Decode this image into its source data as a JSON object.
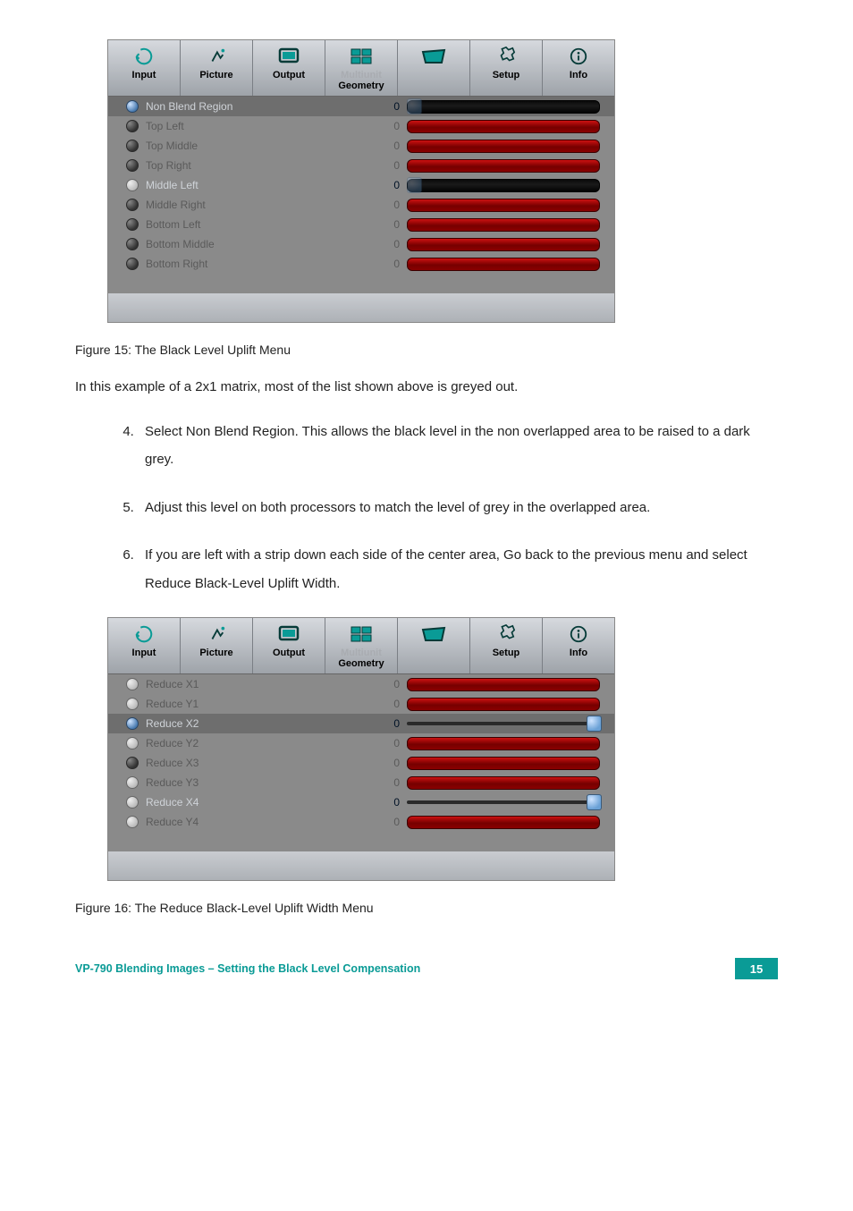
{
  "tabs": {
    "input": "Input",
    "picture": "Picture",
    "output": "Output",
    "multiunit_faded": "Multiunit",
    "geometry": "Geometry",
    "setup": "Setup",
    "info": "Info"
  },
  "panel1": {
    "rows": [
      {
        "label": "Non Blend Region",
        "val": "0",
        "active": true,
        "radio": "sel",
        "track": "dark",
        "highlight": true
      },
      {
        "label": "Top Left",
        "val": "0",
        "active": false,
        "radio": "dark",
        "track": "red"
      },
      {
        "label": "Top Middle",
        "val": "0",
        "active": false,
        "radio": "dark",
        "track": "red"
      },
      {
        "label": "Top Right",
        "val": "0",
        "active": false,
        "radio": "dark",
        "track": "red"
      },
      {
        "label": "Middle Left",
        "val": "0",
        "active": true,
        "radio": "light",
        "track": "dark"
      },
      {
        "label": "Middle Right",
        "val": "0",
        "active": false,
        "radio": "dark",
        "track": "red"
      },
      {
        "label": "Bottom Left",
        "val": "0",
        "active": false,
        "radio": "dark",
        "track": "red"
      },
      {
        "label": "Bottom Middle",
        "val": "0",
        "active": false,
        "radio": "dark",
        "track": "red"
      },
      {
        "label": "Bottom Right",
        "val": "0",
        "active": false,
        "radio": "dark",
        "track": "red"
      }
    ]
  },
  "caption1": "Figure 15: The Black Level Uplift Menu",
  "body1": "In this example of a 2x1 matrix, most of the list shown above is greyed out.",
  "steps": [
    "Select Non Blend Region.\nThis allows the black level in the non overlapped area to be raised to a dark grey.",
    "Adjust this level on both processors to match the level of grey in the overlapped area.",
    "If you are left with a strip down each side of the center area, Go back to the previous menu and select Reduce Black-Level Uplift Width."
  ],
  "panel2": {
    "rows": [
      {
        "label": "Reduce X1",
        "val": "0",
        "active": false,
        "radio": "light",
        "track": "red"
      },
      {
        "label": "Reduce Y1",
        "val": "0",
        "active": false,
        "radio": "light",
        "track": "red"
      },
      {
        "label": "Reduce X2",
        "val": "0",
        "active": true,
        "radio": "sel",
        "track": "thin",
        "highlight": true,
        "thumb": "right"
      },
      {
        "label": "Reduce Y2",
        "val": "0",
        "active": false,
        "radio": "light",
        "track": "red"
      },
      {
        "label": "Reduce X3",
        "val": "0",
        "active": false,
        "radio": "dark",
        "track": "red"
      },
      {
        "label": "Reduce Y3",
        "val": "0",
        "active": false,
        "radio": "light",
        "track": "red"
      },
      {
        "label": "Reduce X4",
        "val": "0",
        "active": true,
        "radio": "light",
        "track": "thin",
        "thumb": "right"
      },
      {
        "label": "Reduce Y4",
        "val": "0",
        "active": false,
        "radio": "light",
        "track": "red"
      }
    ]
  },
  "caption2": "Figure 16: The Reduce Black-Level Uplift Width Menu",
  "footer": {
    "left": "VP-790 Blending Images – Setting the Black Level Compensation",
    "page": "15"
  }
}
